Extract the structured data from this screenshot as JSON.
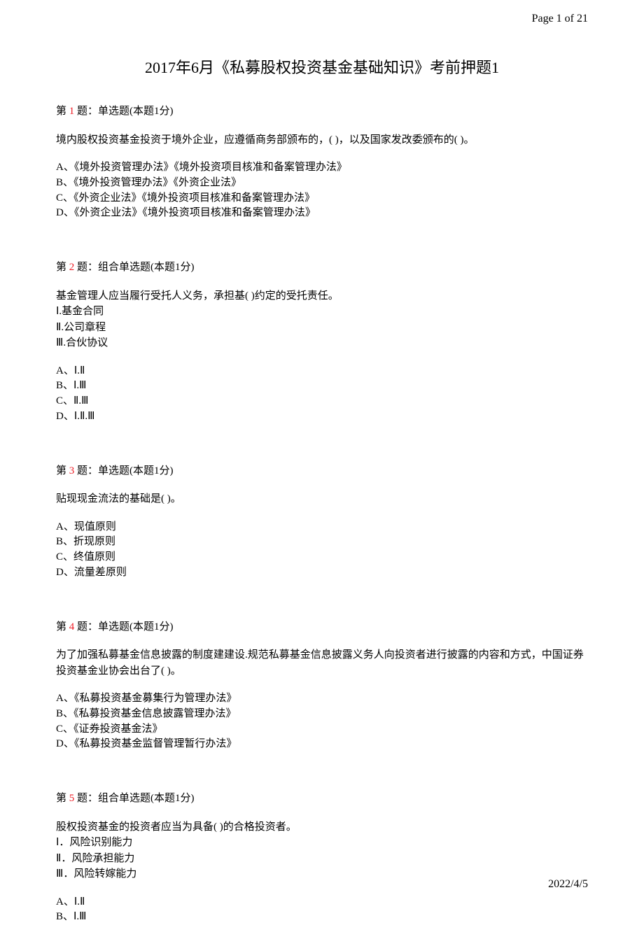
{
  "page_header": "Page 1 of 21",
  "title": "2017年6月《私募股权投资基金基础知识》考前押题1",
  "footer_date": "2022/4/5",
  "questions": [
    {
      "prefix": "第 ",
      "number": "1",
      "label_suffix": " 题：单选题(本题1分)",
      "text": "境内股权投资基金投资于境外企业，应遵循商务部颁布的，(    )，以及国家发改委颁布的(    )。",
      "sub_items": [],
      "options": [
        "A、《境外投资管理办法》《境外投资项目核准和备案管理办法》",
        "B、《境外投资管理办法》《外资企业法》",
        "C、《外资企业法》《境外投资项目核准和备案管理办法》",
        "D、《外资企业法》《境外投资项目核准和备案管理办法》"
      ]
    },
    {
      "prefix": "第 ",
      "number": "2",
      "label_suffix": " 题：组合单选题(本题1分)",
      "text": "基金管理人应当履行受托人义务，承担基(     )约定的受托责任。",
      "sub_items": [
        "Ⅰ.基金合同",
        "Ⅱ.公司章程",
        "Ⅲ.合伙协议"
      ],
      "options": [
        "A、Ⅰ.Ⅱ",
        "B、Ⅰ.Ⅲ",
        "C、Ⅱ.Ⅲ",
        "D、Ⅰ.Ⅱ.Ⅲ"
      ]
    },
    {
      "prefix": "第 ",
      "number": "3",
      "label_suffix": " 题：单选题(本题1分)",
      "text": "贴现现金流法的基础是(    )。",
      "sub_items": [],
      "options": [
        "A、现值原则",
        "B、折现原则",
        "C、终值原则",
        "D、流量差原则"
      ]
    },
    {
      "prefix": "第 ",
      "number": "4",
      "label_suffix": " 题：单选题(本题1分)",
      "text": "为了加强私募基金信息披露的制度建建设.规范私募基金信息披露义务人向投资者进行披露的内容和方式，中国证券投资基金业协会出台了(    )。",
      "sub_items": [],
      "options": [
        "A、《私募投资基金募集行为管理办法》",
        "B、《私募投资基金信息披露管理办法》",
        "C、《证券投资基金法》",
        "D、《私募投资基金监督管理暂行办法》"
      ]
    },
    {
      "prefix": "第 ",
      "number": "5",
      "label_suffix": " 题：组合单选题(本题1分)",
      "text": "股权投资基金的投资者应当为具备(     )的合格投资者。",
      "sub_items": [
        "Ⅰ．风险识别能力",
        "Ⅱ．风险承担能力",
        "Ⅲ．风险转嫁能力"
      ],
      "options": [
        "A、Ⅰ.Ⅱ",
        "B、Ⅰ.Ⅲ"
      ]
    }
  ]
}
